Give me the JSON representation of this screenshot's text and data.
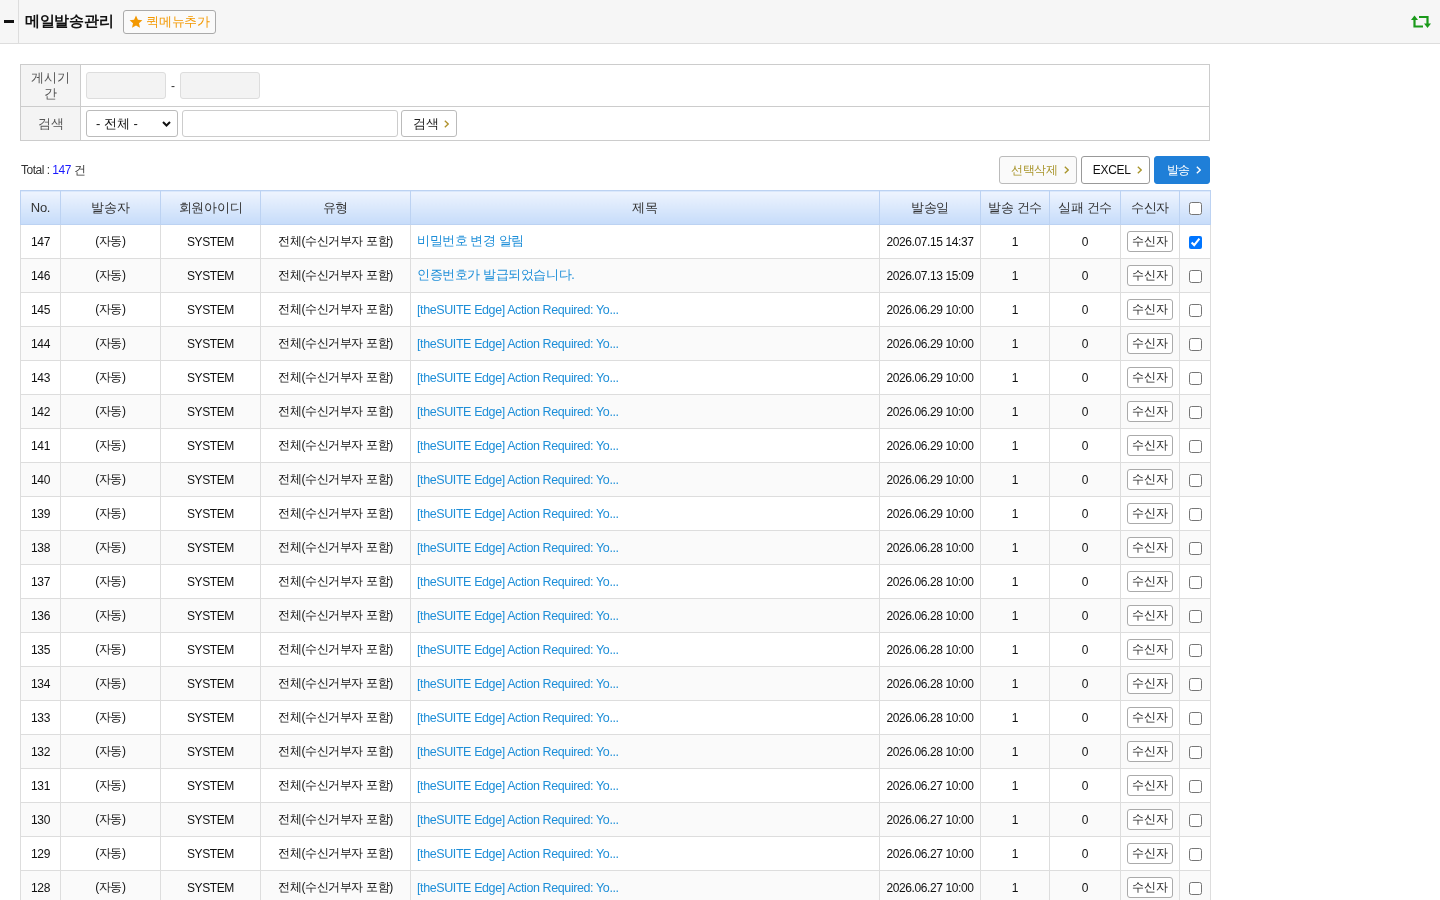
{
  "header": {
    "title": "메일발송관리",
    "quick_menu_button": "퀵메뉴추가"
  },
  "search_form": {
    "period": {
      "label": "게시기간",
      "separator": "-",
      "start_field": {
        "disabled": true
      },
      "end_field": {
        "disabled": true
      }
    },
    "search": {
      "label": "검색",
      "category": "- 전체 -",
      "keyword_field": {
        "disabled": false
      },
      "button": "검색"
    }
  },
  "total": {
    "label": "Total :",
    "count": "147",
    "unit": "건"
  },
  "actions": [
    {
      "kind": "delete",
      "label": "선택삭제"
    },
    {
      "kind": "excel",
      "label": "EXCEL"
    },
    {
      "kind": "send",
      "label": "발송"
    }
  ],
  "table": {
    "columns": [
      "No.",
      "발송자",
      "회원아이디",
      "유형",
      "제목",
      "발송일",
      "발송 건수",
      "실패 건수",
      "수신자"
    ],
    "select_all": {
      "checked": false
    },
    "rows": [
      {
        "no": "147",
        "sender": "(자동)",
        "member_id": "SYSTEM",
        "type": "전체(수신거부자 포함)",
        "subject": "비밀번호 변경 알림",
        "sent_at": "2026.07.15 14:37",
        "sent_count": "1",
        "fail_count": "0",
        "recipients_button": "수신자",
        "checked": true
      },
      {
        "no": "146",
        "sender": "(자동)",
        "member_id": "SYSTEM",
        "type": "전체(수신거부자 포함)",
        "subject": "인증번호가 발급되었습니다.",
        "sent_at": "2026.07.13 15:09",
        "sent_count": "1",
        "fail_count": "0",
        "recipients_button": "수신자",
        "checked": false
      },
      {
        "no": "145",
        "sender": "(자동)",
        "member_id": "SYSTEM",
        "type": "전체(수신거부자 포함)",
        "subject": "[theSUITE Edge] Action Required: Yo...",
        "sent_at": "2026.06.29 10:00",
        "sent_count": "1",
        "fail_count": "0",
        "recipients_button": "수신자",
        "checked": false
      },
      {
        "no": "144",
        "sender": "(자동)",
        "member_id": "SYSTEM",
        "type": "전체(수신거부자 포함)",
        "subject": "[theSUITE Edge] Action Required: Yo...",
        "sent_at": "2026.06.29 10:00",
        "sent_count": "1",
        "fail_count": "0",
        "recipients_button": "수신자",
        "checked": false
      },
      {
        "no": "143",
        "sender": "(자동)",
        "member_id": "SYSTEM",
        "type": "전체(수신거부자 포함)",
        "subject": "[theSUITE Edge] Action Required: Yo...",
        "sent_at": "2026.06.29 10:00",
        "sent_count": "1",
        "fail_count": "0",
        "recipients_button": "수신자",
        "checked": false
      },
      {
        "no": "142",
        "sender": "(자동)",
        "member_id": "SYSTEM",
        "type": "전체(수신거부자 포함)",
        "subject": "[theSUITE Edge] Action Required: Yo...",
        "sent_at": "2026.06.29 10:00",
        "sent_count": "1",
        "fail_count": "0",
        "recipients_button": "수신자",
        "checked": false
      },
      {
        "no": "141",
        "sender": "(자동)",
        "member_id": "SYSTEM",
        "type": "전체(수신거부자 포함)",
        "subject": "[theSUITE Edge] Action Required: Yo...",
        "sent_at": "2026.06.29 10:00",
        "sent_count": "1",
        "fail_count": "0",
        "recipients_button": "수신자",
        "checked": false
      },
      {
        "no": "140",
        "sender": "(자동)",
        "member_id": "SYSTEM",
        "type": "전체(수신거부자 포함)",
        "subject": "[theSUITE Edge] Action Required: Yo...",
        "sent_at": "2026.06.29 10:00",
        "sent_count": "1",
        "fail_count": "0",
        "recipients_button": "수신자",
        "checked": false
      },
      {
        "no": "139",
        "sender": "(자동)",
        "member_id": "SYSTEM",
        "type": "전체(수신거부자 포함)",
        "subject": "[theSUITE Edge] Action Required: Yo...",
        "sent_at": "2026.06.29 10:00",
        "sent_count": "1",
        "fail_count": "0",
        "recipients_button": "수신자",
        "checked": false
      },
      {
        "no": "138",
        "sender": "(자동)",
        "member_id": "SYSTEM",
        "type": "전체(수신거부자 포함)",
        "subject": "[theSUITE Edge] Action Required: Yo...",
        "sent_at": "2026.06.28 10:00",
        "sent_count": "1",
        "fail_count": "0",
        "recipients_button": "수신자",
        "checked": false
      },
      {
        "no": "137",
        "sender": "(자동)",
        "member_id": "SYSTEM",
        "type": "전체(수신거부자 포함)",
        "subject": "[theSUITE Edge] Action Required: Yo...",
        "sent_at": "2026.06.28 10:00",
        "sent_count": "1",
        "fail_count": "0",
        "recipients_button": "수신자",
        "checked": false
      },
      {
        "no": "136",
        "sender": "(자동)",
        "member_id": "SYSTEM",
        "type": "전체(수신거부자 포함)",
        "subject": "[theSUITE Edge] Action Required: Yo...",
        "sent_at": "2026.06.28 10:00",
        "sent_count": "1",
        "fail_count": "0",
        "recipients_button": "수신자",
        "checked": false
      },
      {
        "no": "135",
        "sender": "(자동)",
        "member_id": "SYSTEM",
        "type": "전체(수신거부자 포함)",
        "subject": "[theSUITE Edge] Action Required: Yo...",
        "sent_at": "2026.06.28 10:00",
        "sent_count": "1",
        "fail_count": "0",
        "recipients_button": "수신자",
        "checked": false
      },
      {
        "no": "134",
        "sender": "(자동)",
        "member_id": "SYSTEM",
        "type": "전체(수신거부자 포함)",
        "subject": "[theSUITE Edge] Action Required: Yo...",
        "sent_at": "2026.06.28 10:00",
        "sent_count": "1",
        "fail_count": "0",
        "recipients_button": "수신자",
        "checked": false
      },
      {
        "no": "133",
        "sender": "(자동)",
        "member_id": "SYSTEM",
        "type": "전체(수신거부자 포함)",
        "subject": "[theSUITE Edge] Action Required: Yo...",
        "sent_at": "2026.06.28 10:00",
        "sent_count": "1",
        "fail_count": "0",
        "recipients_button": "수신자",
        "checked": false
      },
      {
        "no": "132",
        "sender": "(자동)",
        "member_id": "SYSTEM",
        "type": "전체(수신거부자 포함)",
        "subject": "[theSUITE Edge] Action Required: Yo...",
        "sent_at": "2026.06.28 10:00",
        "sent_count": "1",
        "fail_count": "0",
        "recipients_button": "수신자",
        "checked": false
      },
      {
        "no": "131",
        "sender": "(자동)",
        "member_id": "SYSTEM",
        "type": "전체(수신거부자 포함)",
        "subject": "[theSUITE Edge] Action Required: Yo...",
        "sent_at": "2026.06.27 10:00",
        "sent_count": "1",
        "fail_count": "0",
        "recipients_button": "수신자",
        "checked": false
      },
      {
        "no": "130",
        "sender": "(자동)",
        "member_id": "SYSTEM",
        "type": "전체(수신거부자 포함)",
        "subject": "[theSUITE Edge] Action Required: Yo...",
        "sent_at": "2026.06.27 10:00",
        "sent_count": "1",
        "fail_count": "0",
        "recipients_button": "수신자",
        "checked": false
      },
      {
        "no": "129",
        "sender": "(자동)",
        "member_id": "SYSTEM",
        "type": "전체(수신거부자 포함)",
        "subject": "[theSUITE Edge] Action Required: Yo...",
        "sent_at": "2026.06.27 10:00",
        "sent_count": "1",
        "fail_count": "0",
        "recipients_button": "수신자",
        "checked": false
      },
      {
        "no": "128",
        "sender": "(자동)",
        "member_id": "SYSTEM",
        "type": "전체(수신거부자 포함)",
        "subject": "[theSUITE Edge] Action Required: Yo...",
        "sent_at": "2026.06.27 10:00",
        "sent_count": "1",
        "fail_count": "0",
        "recipients_button": "수신자",
        "checked": false
      }
    ]
  }
}
